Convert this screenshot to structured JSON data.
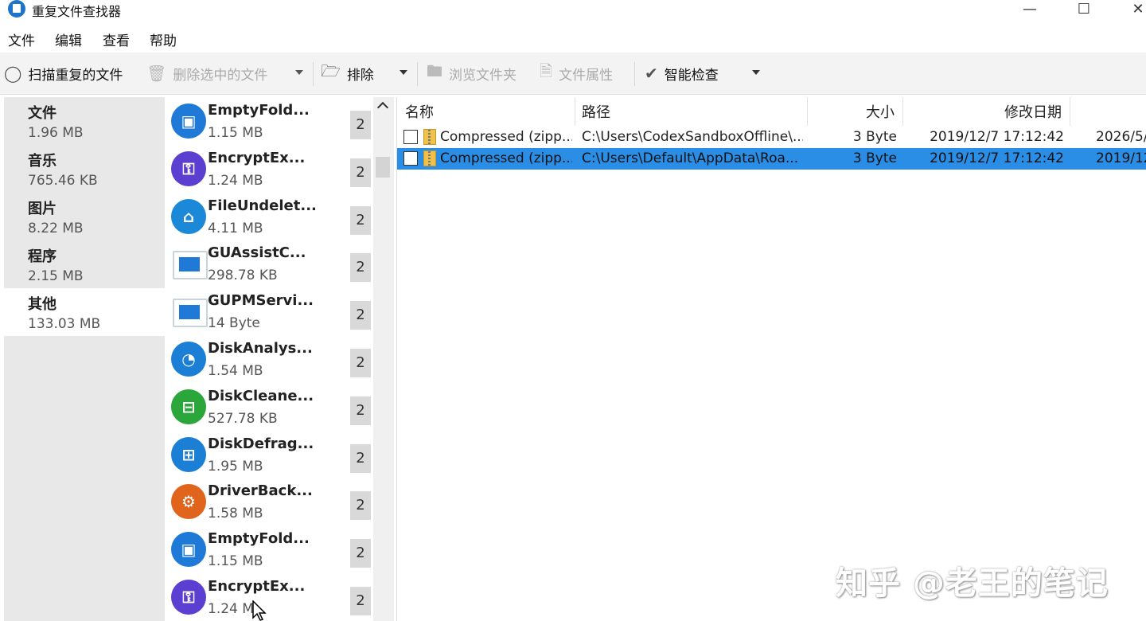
{
  "window": {
    "title": "重复文件查找器",
    "min": "—",
    "max": "☐",
    "close": "✕"
  },
  "menu": [
    "文件",
    "编辑",
    "查看",
    "帮助"
  ],
  "toolbar": {
    "scan": "扫描重复的文件",
    "delete": "删除选中的文件",
    "exclude": "排除",
    "browse": "浏览文件夹",
    "props": "文件属性",
    "smart": "智能检查"
  },
  "categories": [
    {
      "name": "文件",
      "size": "1.96 MB"
    },
    {
      "name": "音乐",
      "size": "765.46 KB"
    },
    {
      "name": "图片",
      "size": "8.22 MB"
    },
    {
      "name": "程序",
      "size": "2.15 MB"
    },
    {
      "name": "其他",
      "size": "133.03 MB"
    }
  ],
  "selected_category": 4,
  "groups": [
    {
      "name": "EmptyFold...",
      "size": "1.15 MB",
      "count": "2",
      "icon": "folder-icon",
      "color": "#1e7ad6"
    },
    {
      "name": "EncryptEx...",
      "size": "1.24 MB",
      "count": "2",
      "icon": "lock-icon",
      "color": "#5b3fd0"
    },
    {
      "name": "FileUndelet...",
      "size": "4.11 MB",
      "count": "2",
      "icon": "recycle-icon",
      "color": "#1b88d8"
    },
    {
      "name": "GUAssistC...",
      "size": "298.78 KB",
      "count": "2",
      "icon": "window-icon",
      "color": "#1e7ad6"
    },
    {
      "name": "GUPMServi...",
      "size": "14 Byte",
      "count": "2",
      "icon": "window-icon",
      "color": "#1e7ad6"
    },
    {
      "name": "DiskAnalys...",
      "size": "1.54 MB",
      "count": "2",
      "icon": "disk-analysis-icon",
      "color": "#1c7fd6"
    },
    {
      "name": "DiskCleane...",
      "size": "527.78 KB",
      "count": "2",
      "icon": "disk-clean-icon",
      "color": "#2aa63a"
    },
    {
      "name": "DiskDefrag...",
      "size": "1.95 MB",
      "count": "2",
      "icon": "disk-defrag-icon",
      "color": "#1c7fd6"
    },
    {
      "name": "DriverBack...",
      "size": "1.58 MB",
      "count": "2",
      "icon": "gear-icon",
      "color": "#e1641c"
    },
    {
      "name": "EmptyFold...",
      "size": "1.15 MB",
      "count": "2",
      "icon": "folder-icon",
      "color": "#1e7ad6"
    },
    {
      "name": "EncryptEx...",
      "size": "1.24 M",
      "count": "2",
      "icon": "lock-icon",
      "color": "#5b3fd0"
    }
  ],
  "table": {
    "headers": [
      "名称",
      "路径",
      "大小",
      "修改日期"
    ],
    "rows": [
      {
        "name": "Compressed (zipp...",
        "path": "C:\\Users\\CodexSandboxOffline\\...",
        "size": "3 Byte",
        "modified": "2019/12/7 17:12:42",
        "extra": "2026/5/",
        "selected": false
      },
      {
        "name": "Compressed (zipp...",
        "path": "C:\\Users\\Default\\AppData\\Roa...",
        "size": "3 Byte",
        "modified": "2019/12/7 17:12:42",
        "extra": "2019/12",
        "selected": true
      }
    ]
  },
  "watermark": "知乎 @老王的笔记"
}
